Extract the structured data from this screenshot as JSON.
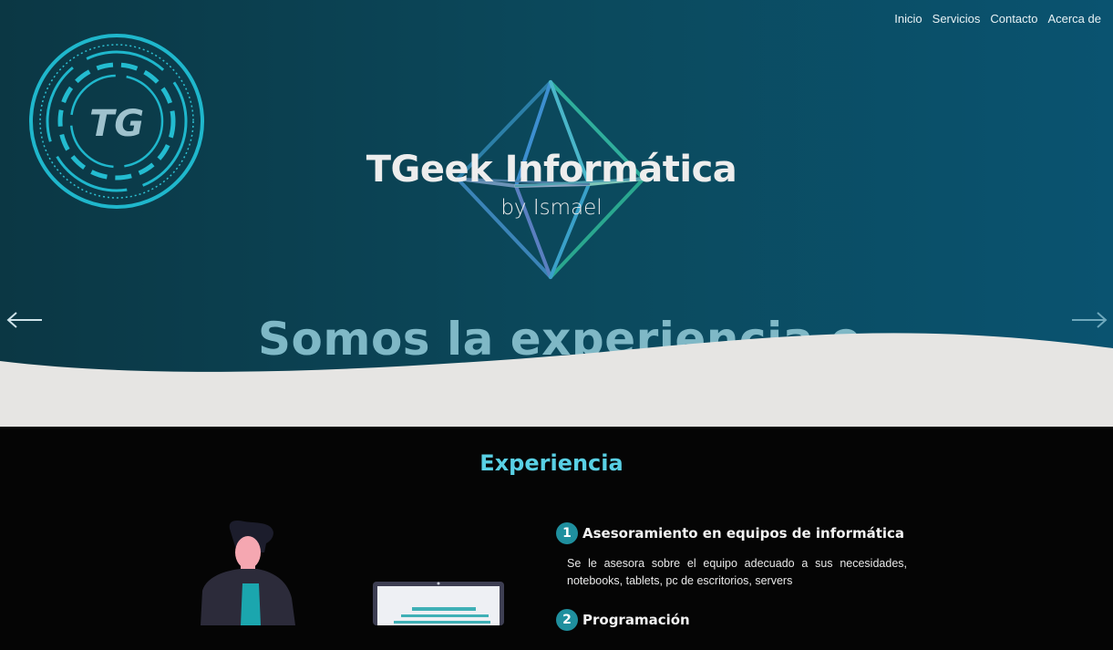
{
  "nav": {
    "items": [
      "Inicio",
      "Servicios",
      "Contacto",
      "Acerca de"
    ]
  },
  "logo": {
    "text": "TG"
  },
  "hero": {
    "title": "TGeek Informática",
    "subtitle": "by Ismael",
    "marquee": "Somos la experiencia e"
  },
  "section": {
    "title": "Experiencia",
    "items": [
      {
        "number": "1",
        "title": "Asesoramiento en equipos de informática",
        "description": "Se le asesora sobre el equipo adecuado a sus necesidades, notebooks, tablets, pc de escritorios, servers"
      },
      {
        "number": "2",
        "title": "Programación",
        "description": ""
      }
    ]
  },
  "icons": {
    "prev": "arrow-left-icon",
    "next": "arrow-right-icon"
  },
  "colors": {
    "accent": "#59d0e4",
    "hero_dark": "#0b3744",
    "hero_light": "#0a5370",
    "wave": "#e6e5e3",
    "badge": "#1f8f9e"
  }
}
